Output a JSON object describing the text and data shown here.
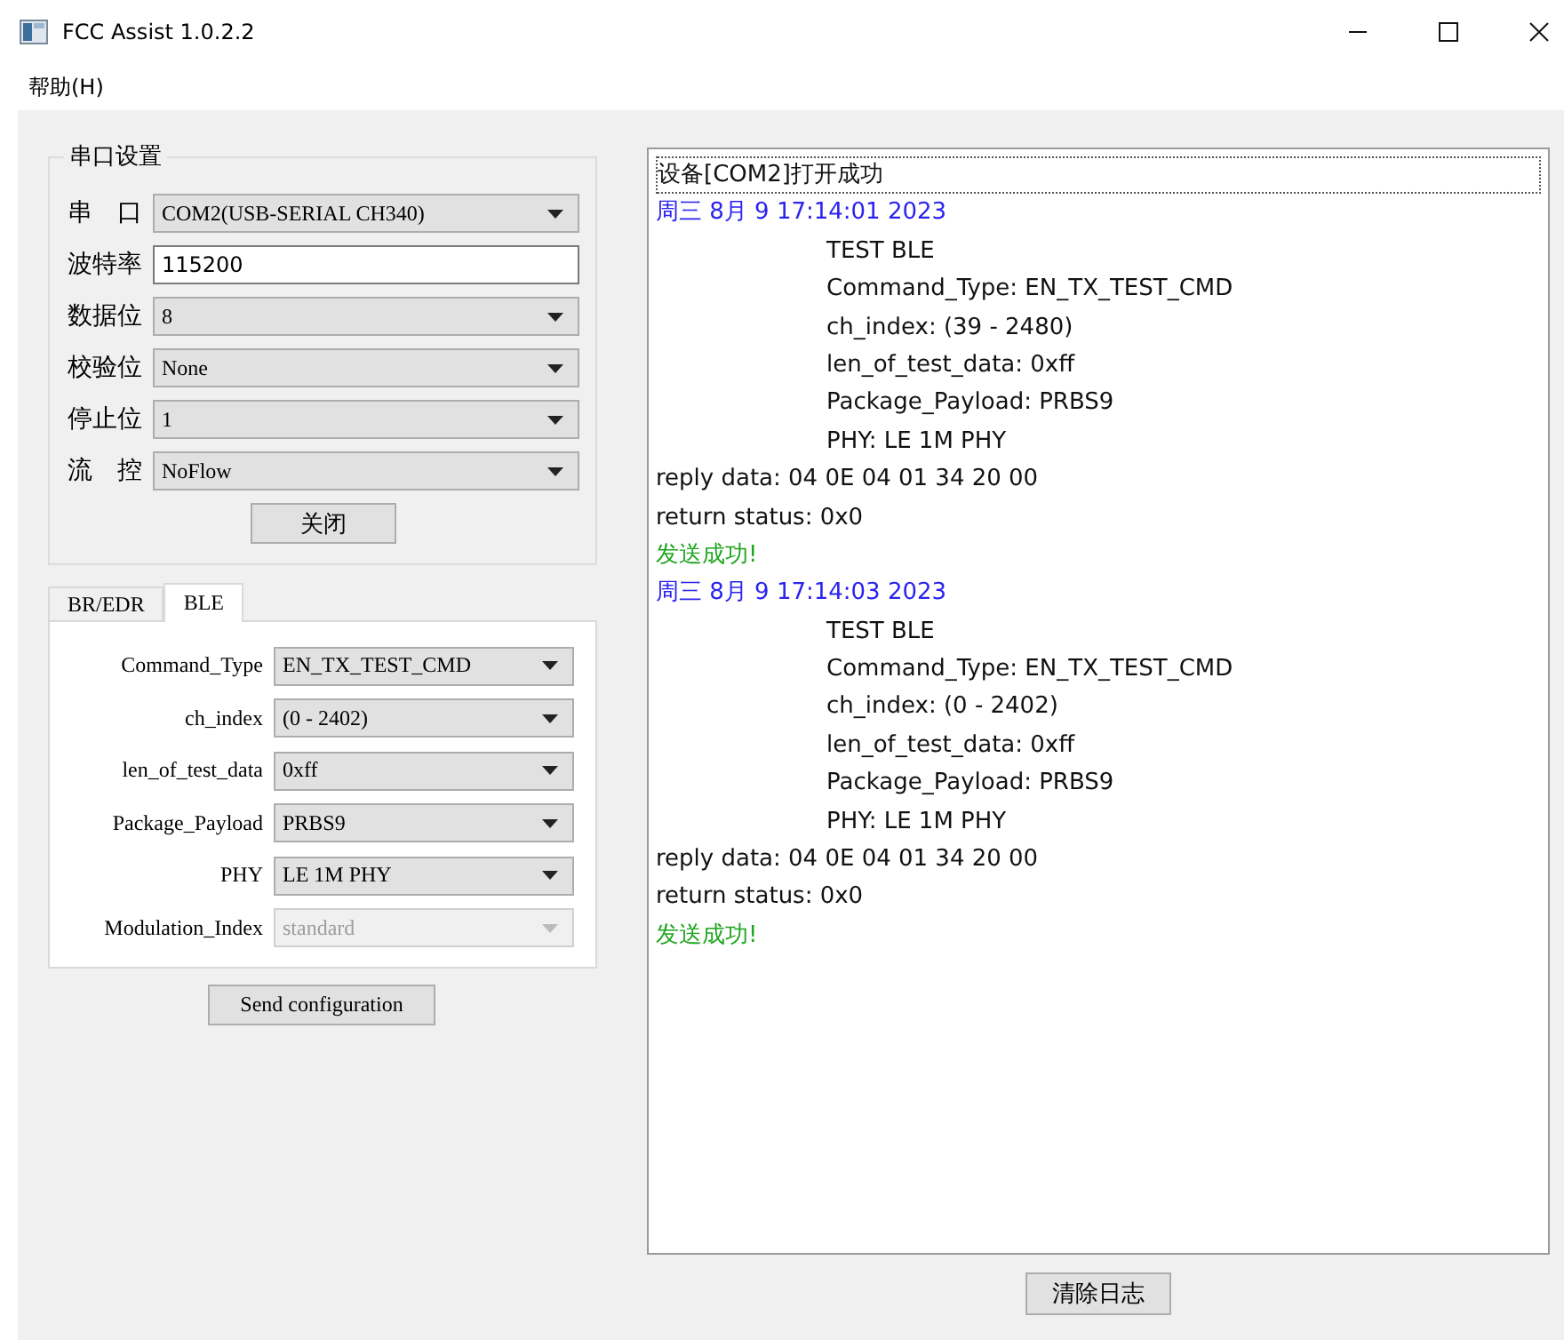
{
  "window": {
    "title": "FCC Assist 1.0.2.2"
  },
  "menu": [
    {
      "label": "帮助(H)"
    }
  ],
  "serial": {
    "title": "串口设置",
    "fields": [
      {
        "label": "串　口",
        "kind": "combo",
        "value": "COM2(USB-SERIAL CH340)"
      },
      {
        "label": "波特率",
        "kind": "input",
        "value": "115200"
      },
      {
        "label": "数据位",
        "kind": "combo",
        "value": "8"
      },
      {
        "label": "校验位",
        "kind": "combo",
        "value": "None"
      },
      {
        "label": "停止位",
        "kind": "combo",
        "value": "1"
      },
      {
        "label": "流　控",
        "kind": "combo",
        "value": "NoFlow"
      }
    ],
    "button": "关闭"
  },
  "tabs": [
    {
      "label": "BR/EDR",
      "selected": false
    },
    {
      "label": "BLE",
      "selected": true
    }
  ],
  "ble": {
    "fields": [
      {
        "label": "Command_Type",
        "value": "EN_TX_TEST_CMD",
        "disabled": false
      },
      {
        "label": "ch_index",
        "value": "(0 - 2402)",
        "disabled": false
      },
      {
        "label": "len_of_test_data",
        "value": "0xff",
        "disabled": false
      },
      {
        "label": "Package_Payload",
        "value": "PRBS9",
        "disabled": false
      },
      {
        "label": "PHY",
        "value": "LE 1M PHY",
        "disabled": false
      },
      {
        "label": "Modulation_Index",
        "value": "standard",
        "disabled": true
      }
    ],
    "button": "Send configuration"
  },
  "log": {
    "lines": [
      {
        "kind": "plain",
        "text": "设备[COM2]打开成功",
        "focused": true
      },
      {
        "kind": "time",
        "text": "周三 8月 9 17:14:01 2023",
        "focused": false
      },
      {
        "kind": "detail",
        "text": "TEST BLE",
        "focused": false
      },
      {
        "kind": "detail",
        "text": "Command_Type: EN_TX_TEST_CMD",
        "focused": false
      },
      {
        "kind": "detail",
        "text": "ch_index: (39 - 2480)",
        "focused": false
      },
      {
        "kind": "detail",
        "text": "len_of_test_data: 0xff",
        "focused": false
      },
      {
        "kind": "detail",
        "text": "Package_Payload: PRBS9",
        "focused": false
      },
      {
        "kind": "detail",
        "text": "PHY: LE 1M PHY",
        "focused": false
      },
      {
        "kind": "plain",
        "text": "reply data: 04 0E 04 01 34 20 00",
        "focused": false
      },
      {
        "kind": "plain",
        "text": "return status: 0x0",
        "focused": false
      },
      {
        "kind": "success",
        "text": "发送成功!",
        "focused": false
      },
      {
        "kind": "time",
        "text": "周三 8月 9 17:14:03 2023",
        "focused": false
      },
      {
        "kind": "detail",
        "text": "TEST BLE",
        "focused": false
      },
      {
        "kind": "detail",
        "text": "Command_Type: EN_TX_TEST_CMD",
        "focused": false
      },
      {
        "kind": "detail",
        "text": "ch_index: (0 - 2402)",
        "focused": false
      },
      {
        "kind": "detail",
        "text": "len_of_test_data: 0xff",
        "focused": false
      },
      {
        "kind": "detail",
        "text": "Package_Payload: PRBS9",
        "focused": false
      },
      {
        "kind": "detail",
        "text": "PHY: LE 1M PHY",
        "focused": false
      },
      {
        "kind": "plain",
        "text": "reply data: 04 0E 04 01 34 20 00",
        "focused": false
      },
      {
        "kind": "plain",
        "text": "return status: 0x0",
        "focused": false
      },
      {
        "kind": "success",
        "text": "发送成功!",
        "focused": false
      }
    ],
    "button": "清除日志"
  }
}
